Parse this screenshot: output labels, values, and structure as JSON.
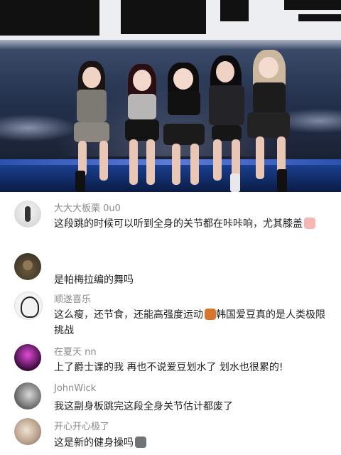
{
  "video": {
    "description_icon": "performance-video-thumbnail"
  },
  "comments": [
    {
      "username": "大大大板栗 0u0",
      "text": "这段跳的时候可以听到全身的关节都在咔咔响，尤其膝盖",
      "emoji": "crying-face-emoji"
    },
    {
      "username": "",
      "text": "是帕梅拉编的舞吗",
      "emoji": ""
    },
    {
      "username": "顺遂喜乐",
      "text": "这么瘦，还节食，还能高强度运动",
      "text2": "韩国爱豆真的是人类极限挑战",
      "emoji": "bag-emoji"
    },
    {
      "username": "在夏天 nn",
      "text": "上了爵士课的我 再也不说爱豆划水了 划水也很累的!",
      "emoji": ""
    },
    {
      "username": "JohnWick",
      "text": "我这副身板跳完这段全身关节估计都废了",
      "emoji": ""
    },
    {
      "username": "开心开心极了",
      "text": "这是新的健身操吗",
      "emoji": "cat-face-emoji"
    }
  ]
}
